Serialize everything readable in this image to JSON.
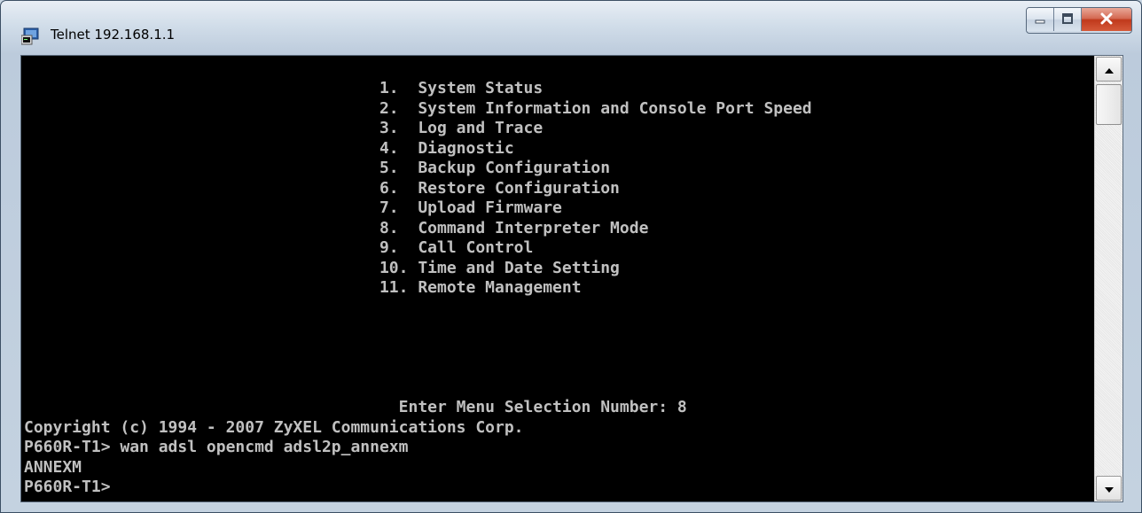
{
  "window": {
    "title": "Telnet 192.168.1.1",
    "icon": "telnet-console-icon"
  },
  "controls": {
    "minimize_icon": "minimize-icon",
    "maximize_icon": "maximize-icon",
    "close_icon": "close-icon"
  },
  "terminal": {
    "lines": [
      "                                     1.  System Status",
      "                                     2.  System Information and Console Port Speed",
      "                                     3.  Log and Trace",
      "                                     4.  Diagnostic",
      "                                     5.  Backup Configuration",
      "                                     6.  Restore Configuration",
      "                                     7.  Upload Firmware",
      "                                     8.  Command Interpreter Mode",
      "                                     9.  Call Control",
      "                                     10. Time and Date Setting",
      "                                     11. Remote Management",
      "",
      "",
      "",
      "",
      "",
      "                                       Enter Menu Selection Number: 8",
      "Copyright (c) 1994 - 2007 ZyXEL Communications Corp.",
      "P660R-T1> wan adsl opencmd adsl2p_annexm",
      "ANNEXM",
      "P660R-T1>"
    ]
  },
  "scrollbar": {
    "up_icon": "scroll-up-arrow-icon",
    "down_icon": "scroll-down-arrow-icon"
  },
  "colors": {
    "terminal_bg": "#000000",
    "terminal_fg": "#c0c0c0",
    "close_button": "#c7432a"
  }
}
